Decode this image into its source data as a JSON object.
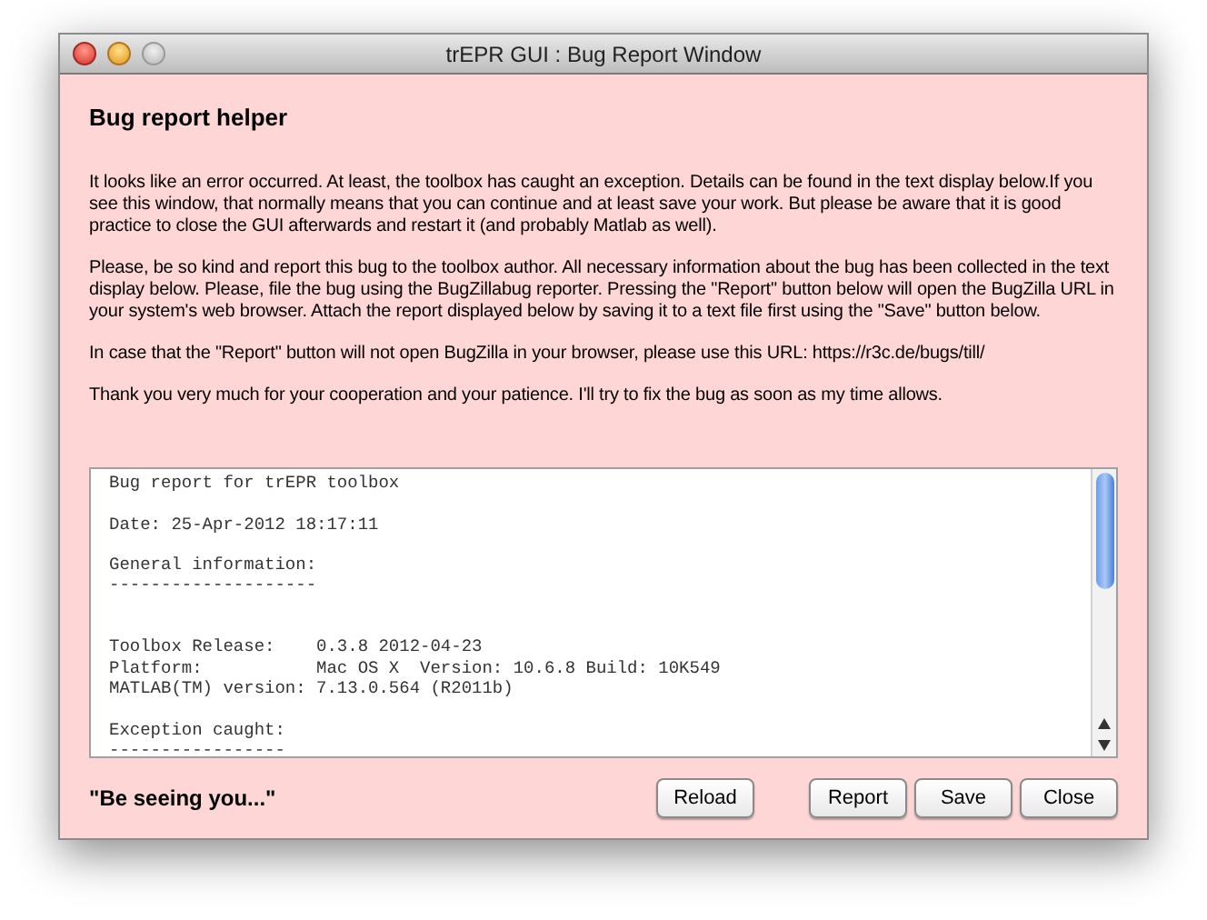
{
  "window": {
    "title": "trEPR GUI : Bug Report Window"
  },
  "heading": "Bug report helper",
  "paragraphs": [
    "It looks like an error occurred. At least, the toolbox has caught an exception. Details can be found in the text display below.If you see this window, that normally means that you can continue and at least save your work. But please be aware that it is good practice to close the GUI afterwards and restart it (and probably Matlab as well).",
    "Please, be so kind and report this bug to the toolbox author. All necessary information about the bug has been collected in the text display below. Please, file the bug using the BugZillabug reporter. Pressing the \"Report\" button below will open the BugZilla URL in your system's web browser. Attach the report displayed below by saving it to a text file first using the \"Save\" button below.",
    "In case that the \"Report\" button will not open BugZilla in your browser, please use this URL: https://r3c.de/bugs/till/",
    "Thank you very much for your cooperation and your patience. I'll try to fix the bug as soon as my time allows."
  ],
  "report_blocks": [
    {
      "kind": "no_gap",
      "lines": [
        "Bug report for trEPR toolbox"
      ]
    },
    {
      "kind": "single_gap",
      "lines": [
        "Date: 25-Apr-2012 18:17:11"
      ]
    },
    {
      "kind": "single_gap",
      "lines": [
        "General information:",
        "--------------------"
      ]
    },
    {
      "kind": "double_gap",
      "lines": [
        "Toolbox Release:    0.3.8 2012-04-23",
        "Platform:           Mac OS X  Version: 10.6.8 Build: 10K549",
        "MATLAB(TM) version: 7.13.0.564 (R2011b)"
      ]
    },
    {
      "kind": "single_gap",
      "lines": [
        "Exception caught:",
        "-----------------"
      ]
    }
  ],
  "footer_text": "\"Be seeing you...\"",
  "buttons": [
    {
      "label": "Reload",
      "kind": "left"
    },
    {
      "label": "Report",
      "kind": "right"
    },
    {
      "label": "Save",
      "kind": "right"
    },
    {
      "label": "Close",
      "kind": "right"
    }
  ]
}
